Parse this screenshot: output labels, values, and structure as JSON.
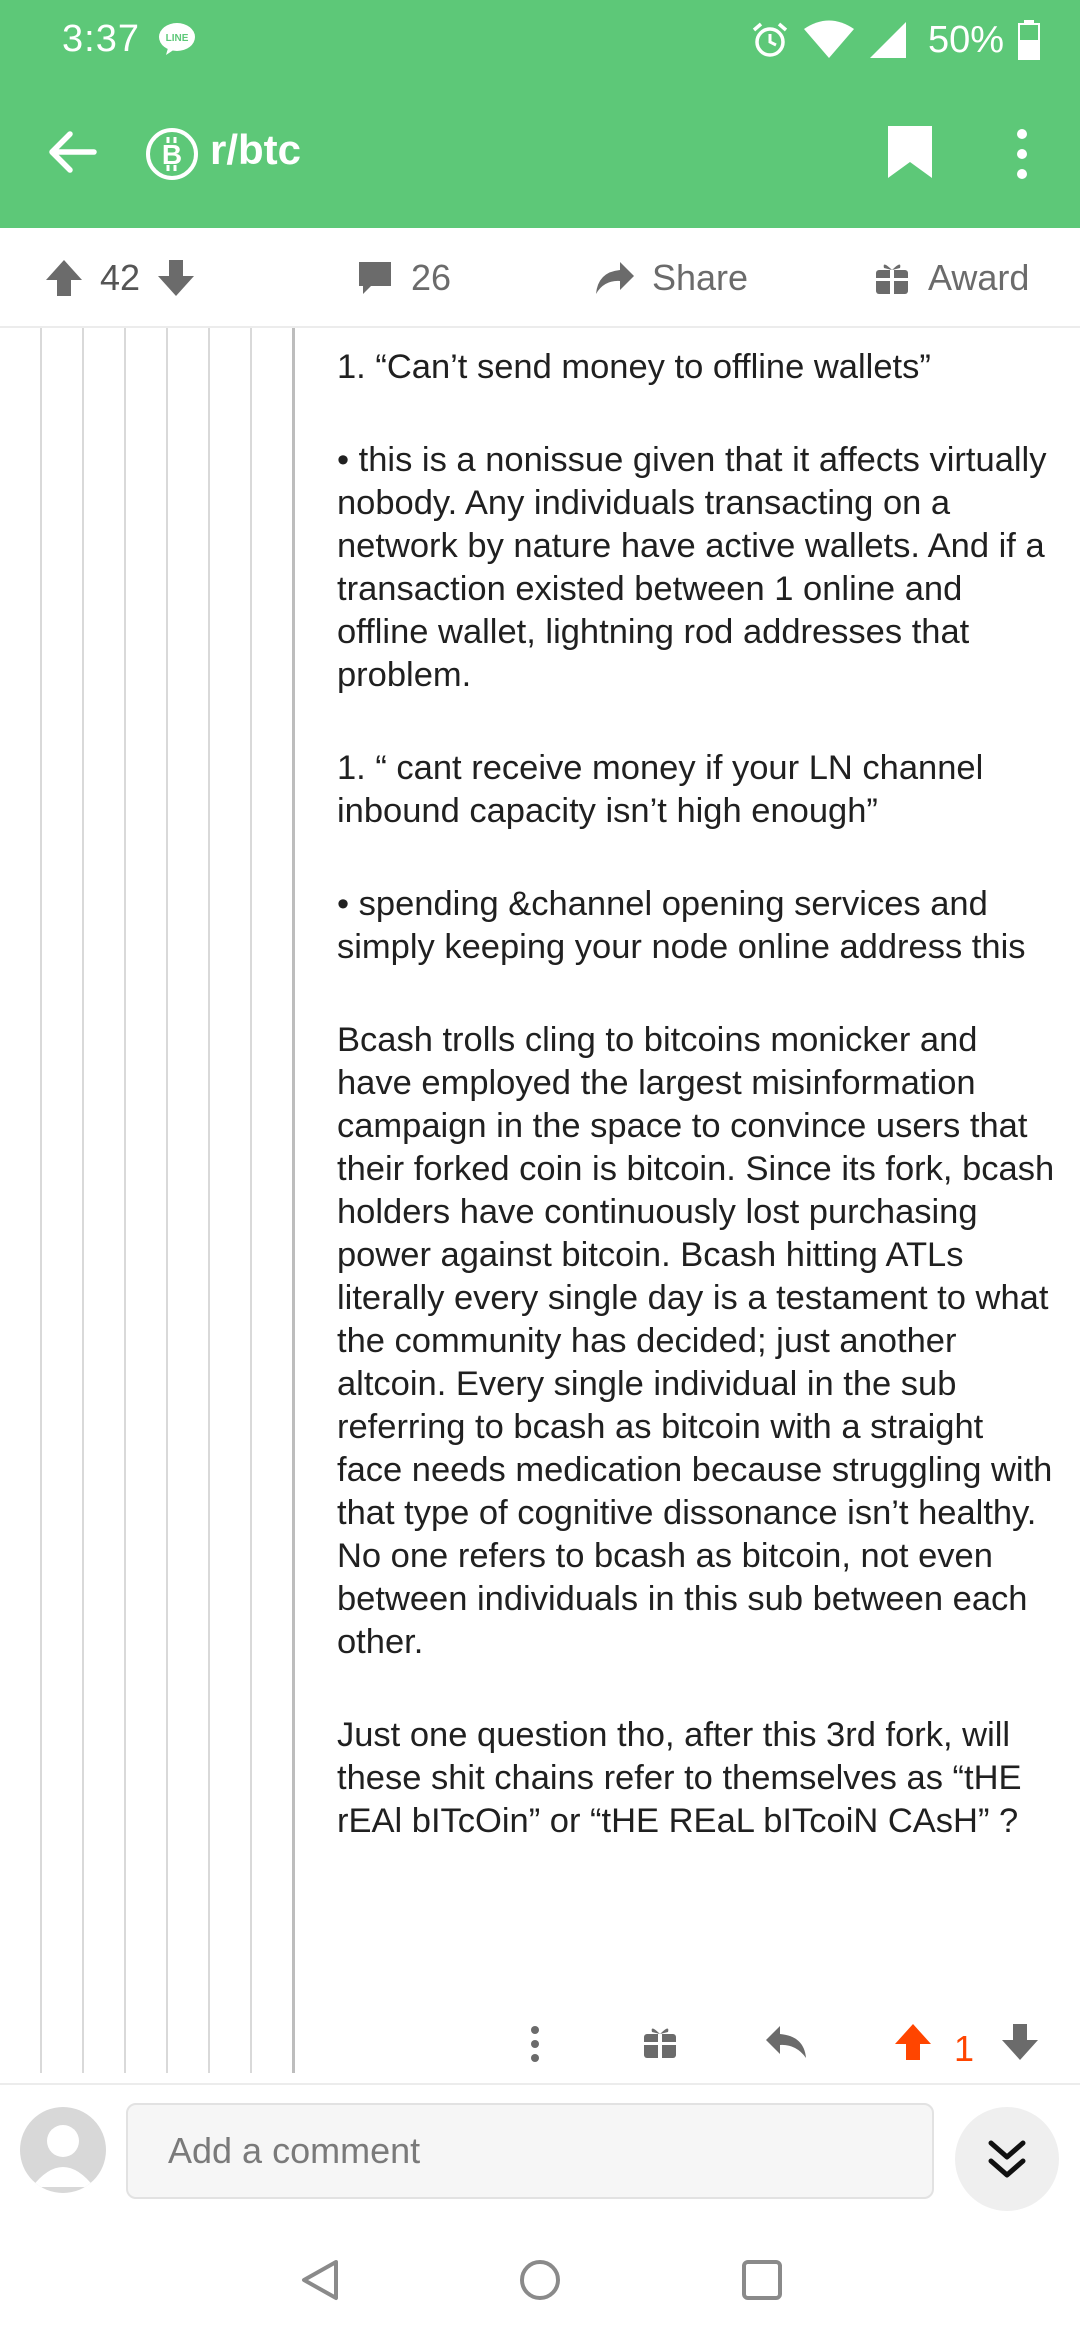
{
  "status_bar": {
    "time": "3:37",
    "battery": "50%"
  },
  "app_bar": {
    "subreddit": "r/btc"
  },
  "post_actions": {
    "upvotes": "42",
    "comments": "26",
    "share_label": "Share",
    "award_label": "Award"
  },
  "comment": {
    "paragraphs": [
      "1. “Can’t send money to offline wallets”",
      "• this is a nonissue given that it affects virtually nobody. Any individuals transacting on a network by nature have active wallets. And if a transaction existed between 1 online and offline wallet, lightning rod addresses that problem.",
      "1. “ cant receive money if your LN channel inbound capacity isn’t high enough”",
      "• spending &channel opening services and simply keeping your node online address this",
      "Bcash trolls cling to bitcoins monicker and have employed the largest misinformation campaign in the space to convince users that their forked coin is bitcoin. Since its fork, bcash holders have continuously lost purchasing power against bitcoin. Bcash hitting ATLs literally every single day is a testament to what the community has decided; just another altcoin. Every single individual in the sub referring to bcash as bitcoin with a straight face needs medication because struggling with that type of cognitive dissonance isn’t healthy. No one refers to bcash as bitcoin, not even between individuals in this sub between each other.",
      "Just one question tho, after this 3rd fork, will these shit chains refer to themselves as “tHE rEAl bITcOin” or “tHE REaL bITcoiN CAsH” ?"
    ],
    "score": "1",
    "upvote_color": "#ff4500"
  },
  "composer": {
    "placeholder": "Add a comment"
  },
  "colors": {
    "header": "#5dc878",
    "icon_gray": "#6b6b6b"
  }
}
